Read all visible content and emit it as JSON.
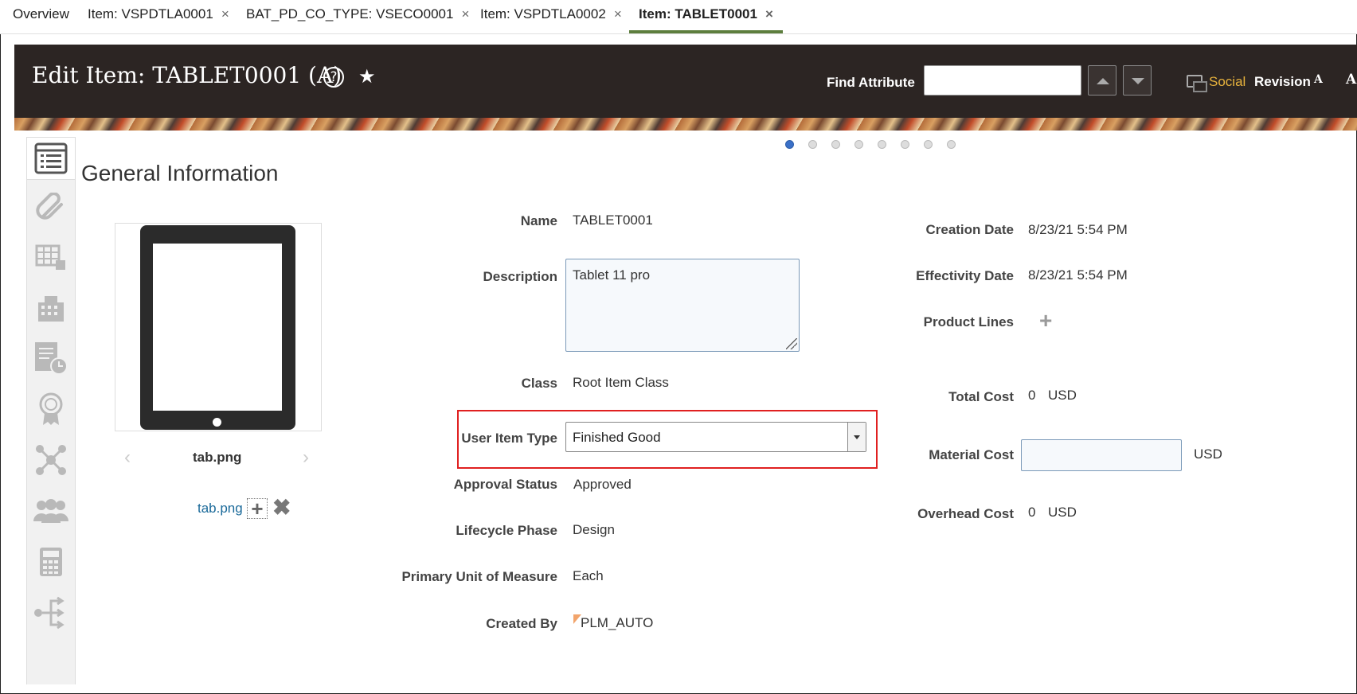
{
  "tabs": [
    {
      "label": "Overview",
      "closable": false
    },
    {
      "label": "Item: VSPDTLA0001",
      "closable": true
    },
    {
      "label": "BAT_PD_CO_TYPE: VSECO0001",
      "closable": true
    },
    {
      "label": "Item: VSPDTLA0002",
      "closable": true
    },
    {
      "label": "Item: TABLET0001",
      "closable": true,
      "active": true
    }
  ],
  "close_glyph": "×",
  "header": {
    "title": "Edit Item: TABLET0001 (A)",
    "help_glyph": "?",
    "favorite_glyph": "★",
    "find_label": "Find Attribute",
    "find_value": "",
    "social": "Social",
    "revision": "Revision",
    "font_small": "A",
    "font_large": "A"
  },
  "sidebar": [
    "general-information",
    "attachments",
    "specifications",
    "structure",
    "history",
    "quality",
    "relationships",
    "team",
    "costs",
    "workflow"
  ],
  "carousel": {
    "pages": 8,
    "current": 1
  },
  "section_title": "General Information",
  "image": {
    "file_name": "tab.png",
    "link_text": "tab.png",
    "prev_glyph": "‹",
    "next_glyph": "›",
    "add_glyph": "+",
    "delete_glyph": "✖"
  },
  "form": {
    "name": {
      "label": "Name",
      "value": "TABLET0001"
    },
    "description": {
      "label": "Description",
      "value": "Tablet 11 pro"
    },
    "class": {
      "label": "Class",
      "value": "Root Item Class"
    },
    "user_item_type": {
      "label": "User Item Type",
      "value": "Finished Good"
    },
    "approval_status": {
      "label": "Approval Status",
      "value": "Approved"
    },
    "lifecycle_phase": {
      "label": "Lifecycle Phase",
      "value": "Design"
    },
    "uom": {
      "label": "Primary Unit of Measure",
      "value": "Each"
    },
    "created_by": {
      "label": "Created By",
      "value": "PLM_AUTO"
    }
  },
  "right": {
    "creation_date": {
      "label": "Creation Date",
      "value": "8/23/21 5:54 PM"
    },
    "effectivity_date": {
      "label": "Effectivity Date",
      "value": "8/23/21 5:54 PM"
    },
    "product_lines": {
      "label": "Product Lines",
      "add_glyph": "+"
    },
    "total_cost": {
      "label": "Total Cost",
      "value": "0",
      "currency": "USD"
    },
    "material_cost": {
      "label": "Material Cost",
      "value": "",
      "currency": "USD"
    },
    "overhead_cost": {
      "label": "Overhead Cost",
      "value": "0",
      "currency": "USD"
    }
  },
  "colors": {
    "header_bg": "#2c2523",
    "active_tab": "#5d7e3e",
    "social": "#e8b33d",
    "link": "#1b6a9a",
    "highlight": "#e02020"
  }
}
